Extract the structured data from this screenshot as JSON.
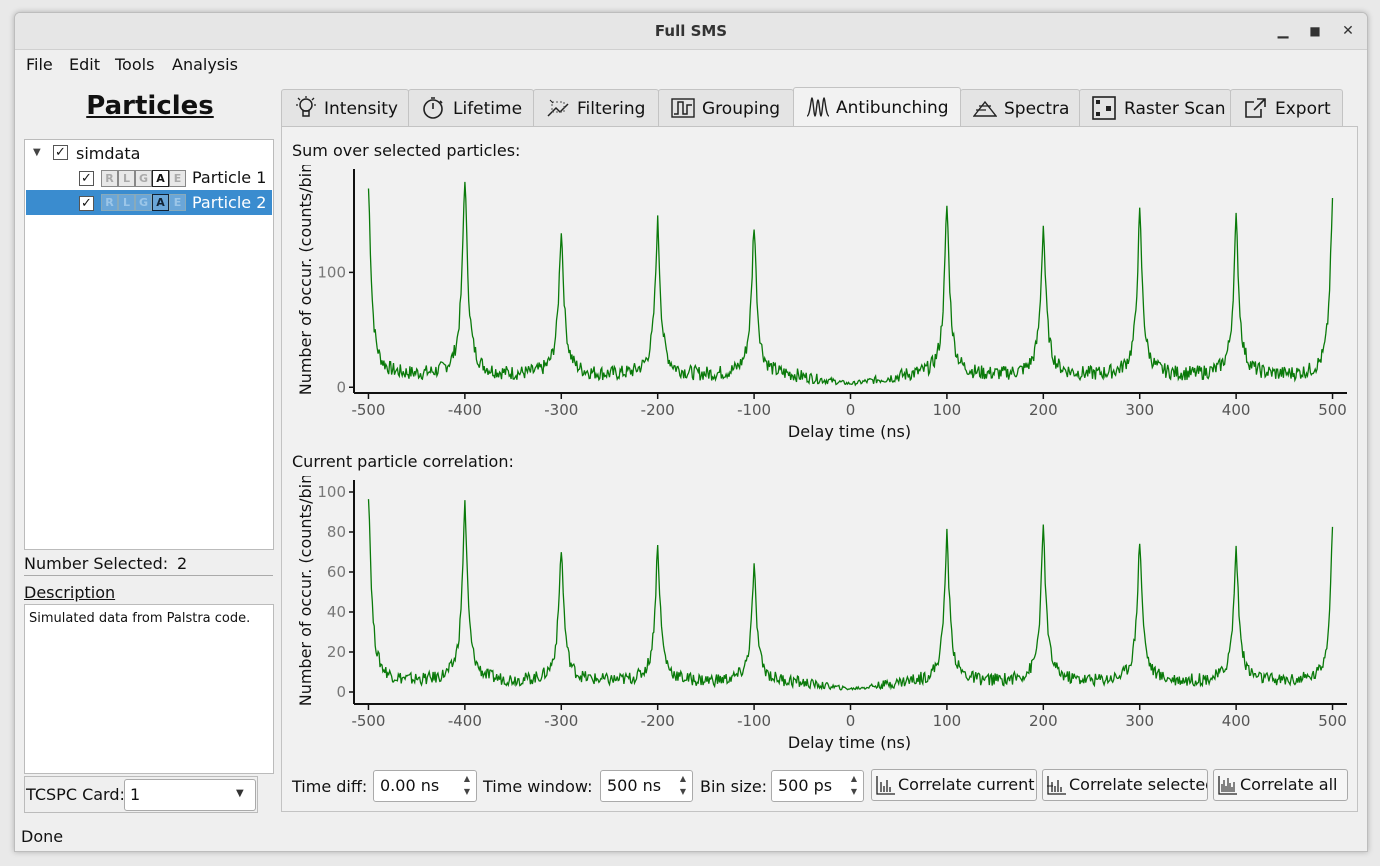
{
  "window": {
    "title": "Full SMS"
  },
  "menu": [
    "File",
    "Edit",
    "Tools",
    "Analysis"
  ],
  "sidebar": {
    "title": "Particles",
    "tree": {
      "root": "simdata",
      "items": [
        {
          "label": "Particle 1",
          "checked": true,
          "selected": false,
          "tags": [
            "R",
            "L",
            "G",
            "A",
            "E"
          ]
        },
        {
          "label": "Particle 2",
          "checked": true,
          "selected": true,
          "tags": [
            "R",
            "L",
            "G",
            "A",
            "E"
          ]
        }
      ]
    },
    "number_selected_label": "Number Selected:",
    "number_selected": "2",
    "description_label": "Description",
    "description_text": "Simulated data from Palstra code.",
    "tcspc_label": "TCSPC Card:",
    "tcspc_value": "1"
  },
  "tabs": [
    {
      "label": "Intensity",
      "icon": "bulb-icon"
    },
    {
      "label": "Lifetime",
      "icon": "stopwatch-icon"
    },
    {
      "label": "Filtering",
      "icon": "filter-icon"
    },
    {
      "label": "Grouping",
      "icon": "grouping-icon"
    },
    {
      "label": "Antibunching",
      "icon": "antibunching-icon",
      "active": true
    },
    {
      "label": "Spectra",
      "icon": "spectra-icon"
    },
    {
      "label": "Raster Scan",
      "icon": "raster-icon"
    },
    {
      "label": "Export",
      "icon": "export-icon"
    }
  ],
  "plots": {
    "top_label": "Sum over selected particles:",
    "bottom_label": "Current particle correlation:"
  },
  "controls": {
    "time_diff_label": "Time diff:",
    "time_diff_value": "0.00 ns",
    "time_window_label": "Time window:",
    "time_window_value": "500 ns",
    "bin_size_label": "Bin size:",
    "bin_size_value": "500 ps",
    "correlate_current": "Correlate current",
    "correlate_selected": "Correlate selected",
    "correlate_all": "Correlate all"
  },
  "status": "Done",
  "colors": {
    "line": "#0a7a0a",
    "selection": "#3a8ccf"
  },
  "chart_data": [
    {
      "type": "line",
      "title": "Sum over selected particles:",
      "xlabel": "Delay time (ns)",
      "ylabel": "Number of occur. (counts/bin",
      "xlim": [
        -515,
        515
      ],
      "ylim": [
        -5,
        190
      ],
      "xticks": [
        -500,
        -400,
        -300,
        -200,
        -100,
        0,
        100,
        200,
        300,
        400,
        500
      ],
      "yticks": [
        0,
        100
      ],
      "peaks": [
        {
          "x": -500,
          "y": 172
        },
        {
          "x": -400,
          "y": 182
        },
        {
          "x": -300,
          "y": 136
        },
        {
          "x": -200,
          "y": 143
        },
        {
          "x": -100,
          "y": 141
        },
        {
          "x": 100,
          "y": 157
        },
        {
          "x": 200,
          "y": 139
        },
        {
          "x": 300,
          "y": 150
        },
        {
          "x": 400,
          "y": 145
        },
        {
          "x": 500,
          "y": 158
        }
      ],
      "baseline": 8,
      "series": [
        {
          "color": "#0a7a0a"
        }
      ]
    },
    {
      "type": "line",
      "title": "Current particle correlation:",
      "xlabel": "Delay time (ns)",
      "ylabel": "Number of occur. (counts/bin",
      "xlim": [
        -515,
        515
      ],
      "ylim": [
        -6,
        106
      ],
      "xticks": [
        -500,
        -400,
        -300,
        -200,
        -100,
        0,
        100,
        200,
        300,
        400,
        500
      ],
      "yticks": [
        0,
        20,
        40,
        60,
        80,
        100
      ],
      "peaks": [
        {
          "x": -500,
          "y": 99
        },
        {
          "x": -400,
          "y": 94
        },
        {
          "x": -300,
          "y": 71
        },
        {
          "x": -200,
          "y": 72
        },
        {
          "x": -100,
          "y": 61
        },
        {
          "x": 100,
          "y": 78
        },
        {
          "x": 200,
          "y": 81
        },
        {
          "x": 300,
          "y": 75
        },
        {
          "x": 400,
          "y": 71
        },
        {
          "x": 500,
          "y": 79
        }
      ],
      "baseline": 4,
      "series": [
        {
          "color": "#0a7a0a"
        }
      ]
    }
  ]
}
